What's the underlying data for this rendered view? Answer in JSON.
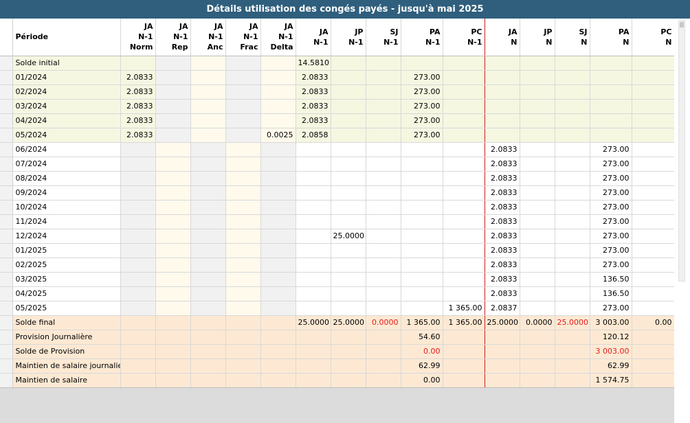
{
  "title": "Détails utilisation des congés payés - jusqu'à mai 2025",
  "headers": [
    {
      "key": "periode",
      "lines": [
        "Période"
      ]
    },
    {
      "key": "ja_n1_norm",
      "lines": [
        "JA",
        "N-1",
        "Norm"
      ]
    },
    {
      "key": "ja_n1_rep",
      "lines": [
        "JA",
        "N-1",
        "Rep"
      ]
    },
    {
      "key": "ja_n1_anc",
      "lines": [
        "JA",
        "N-1",
        "Anc"
      ]
    },
    {
      "key": "ja_n1_frac",
      "lines": [
        "JA",
        "N-1",
        "Frac"
      ]
    },
    {
      "key": "ja_n1_delta",
      "lines": [
        "JA",
        "N-1",
        "Delta"
      ]
    },
    {
      "key": "ja_n1",
      "lines": [
        "JA",
        "N-1"
      ]
    },
    {
      "key": "jp_n1",
      "lines": [
        "JP",
        "N-1"
      ]
    },
    {
      "key": "sj_n1",
      "lines": [
        "SJ",
        "N-1"
      ]
    },
    {
      "key": "pa_n1",
      "lines": [
        "PA",
        "N-1"
      ]
    },
    {
      "key": "pc_n1",
      "lines": [
        "PC",
        "N-1"
      ]
    },
    {
      "key": "ja_n",
      "lines": [
        "JA",
        "N"
      ]
    },
    {
      "key": "jp_n",
      "lines": [
        "JP",
        "N"
      ]
    },
    {
      "key": "sj_n",
      "lines": [
        "SJ",
        "N"
      ]
    },
    {
      "key": "pa_n",
      "lines": [
        "PA",
        "N"
      ]
    },
    {
      "key": "pc_n",
      "lines": [
        "PC",
        "N"
      ]
    }
  ],
  "rows": [
    {
      "style": "green",
      "cells": [
        "Solde initial",
        "",
        "",
        "",
        "",
        "",
        "14.5810",
        "",
        "",
        "",
        "",
        "",
        "",
        "",
        "",
        ""
      ]
    },
    {
      "style": "green",
      "cells": [
        "01/2024",
        "2.0833",
        "",
        "",
        "",
        "",
        "2.0833",
        "",
        "",
        "273.00",
        "",
        "",
        "",
        "",
        "",
        ""
      ]
    },
    {
      "style": "green",
      "cells": [
        "02/2024",
        "2.0833",
        "",
        "",
        "",
        "",
        "2.0833",
        "",
        "",
        "273.00",
        "",
        "",
        "",
        "",
        "",
        ""
      ]
    },
    {
      "style": "green",
      "cells": [
        "03/2024",
        "2.0833",
        "",
        "",
        "",
        "",
        "2.0833",
        "",
        "",
        "273.00",
        "",
        "",
        "",
        "",
        "",
        ""
      ]
    },
    {
      "style": "green",
      "cells": [
        "04/2024",
        "2.0833",
        "",
        "",
        "",
        "",
        "2.0833",
        "",
        "",
        "273.00",
        "",
        "",
        "",
        "",
        "",
        ""
      ]
    },
    {
      "style": "green",
      "cells": [
        "05/2024",
        "2.0833",
        "",
        "",
        "",
        "0.0025",
        "2.0858",
        "",
        "",
        "273.00",
        "",
        "",
        "",
        "",
        "",
        ""
      ]
    },
    {
      "style": "white",
      "cells": [
        "06/2024",
        "",
        "",
        "",
        "",
        "",
        "",
        "",
        "",
        "",
        "",
        "2.0833",
        "",
        "",
        "273.00",
        ""
      ]
    },
    {
      "style": "white",
      "cells": [
        "07/2024",
        "",
        "",
        "",
        "",
        "",
        "",
        "",
        "",
        "",
        "",
        "2.0833",
        "",
        "",
        "273.00",
        ""
      ]
    },
    {
      "style": "white",
      "cells": [
        "08/2024",
        "",
        "",
        "",
        "",
        "",
        "",
        "",
        "",
        "",
        "",
        "2.0833",
        "",
        "",
        "273.00",
        ""
      ]
    },
    {
      "style": "white",
      "cells": [
        "09/2024",
        "",
        "",
        "",
        "",
        "",
        "",
        "",
        "",
        "",
        "",
        "2.0833",
        "",
        "",
        "273.00",
        ""
      ]
    },
    {
      "style": "white",
      "cells": [
        "10/2024",
        "",
        "",
        "",
        "",
        "",
        "",
        "",
        "",
        "",
        "",
        "2.0833",
        "",
        "",
        "273.00",
        ""
      ]
    },
    {
      "style": "white",
      "cells": [
        "11/2024",
        "",
        "",
        "",
        "",
        "",
        "",
        "",
        "",
        "",
        "",
        "2.0833",
        "",
        "",
        "273.00",
        ""
      ]
    },
    {
      "style": "white",
      "cells": [
        "12/2024",
        "",
        "",
        "",
        "",
        "",
        "",
        "25.0000",
        "",
        "",
        "",
        "2.0833",
        "",
        "",
        "273.00",
        ""
      ]
    },
    {
      "style": "white",
      "cells": [
        "01/2025",
        "",
        "",
        "",
        "",
        "",
        "",
        "",
        "",
        "",
        "",
        "2.0833",
        "",
        "",
        "273.00",
        ""
      ]
    },
    {
      "style": "white",
      "cells": [
        "02/2025",
        "",
        "",
        "",
        "",
        "",
        "",
        "",
        "",
        "",
        "",
        "2.0833",
        "",
        "",
        "273.00",
        ""
      ]
    },
    {
      "style": "white",
      "cells": [
        "03/2025",
        "",
        "",
        "",
        "",
        "",
        "",
        "",
        "",
        "",
        "",
        "2.0833",
        "",
        "",
        "136.50",
        ""
      ]
    },
    {
      "style": "white",
      "cells": [
        "04/2025",
        "",
        "",
        "",
        "",
        "",
        "",
        "",
        "",
        "",
        "",
        "2.0833",
        "",
        "",
        "136.50",
        ""
      ]
    },
    {
      "style": "white",
      "cells": [
        "05/2025",
        "",
        "",
        "",
        "",
        "",
        "",
        "",
        "",
        "",
        "1 365.00",
        "2.0837",
        "",
        "",
        "273.00",
        ""
      ]
    },
    {
      "style": "orange",
      "cells": [
        "Solde final",
        "",
        "",
        "",
        "",
        "",
        "25.0000",
        "25.0000",
        "0.0000",
        "1 365.00",
        "1 365.00",
        "25.0000",
        "0.0000",
        "25.0000",
        "3 003.00",
        "0.00"
      ]
    },
    {
      "style": "orange",
      "cells": [
        "Provision Journalière",
        "",
        "",
        "",
        "",
        "",
        "",
        "",
        "",
        "54.60",
        "",
        "",
        "",
        "",
        "120.12",
        ""
      ]
    },
    {
      "style": "orange",
      "cells": [
        "Solde de Provision",
        "",
        "",
        "",
        "",
        "",
        "",
        "",
        "",
        "0.00",
        "",
        "",
        "",
        "",
        "3 003.00",
        ""
      ]
    },
    {
      "style": "orange",
      "cells": [
        "Maintien de salaire journalier",
        "",
        "",
        "",
        "",
        "",
        "",
        "",
        "",
        "62.99",
        "",
        "",
        "",
        "",
        "62.99",
        ""
      ]
    },
    {
      "style": "orange",
      "cells": [
        "Maintien de salaire",
        "",
        "",
        "",
        "",
        "",
        "",
        "",
        "",
        "0.00",
        "",
        "",
        "",
        "",
        "1 574.75",
        ""
      ]
    }
  ],
  "red_cells": [
    [
      18,
      8
    ],
    [
      18,
      13
    ],
    [
      20,
      9
    ],
    [
      20,
      14
    ]
  ],
  "colors": {
    "title_bg": "#2f5f7d",
    "green_row": "#f5f7e1",
    "orange_row": "#fde9d3",
    "red_text": "#e21b1b",
    "separator": "#cc1b1b"
  }
}
